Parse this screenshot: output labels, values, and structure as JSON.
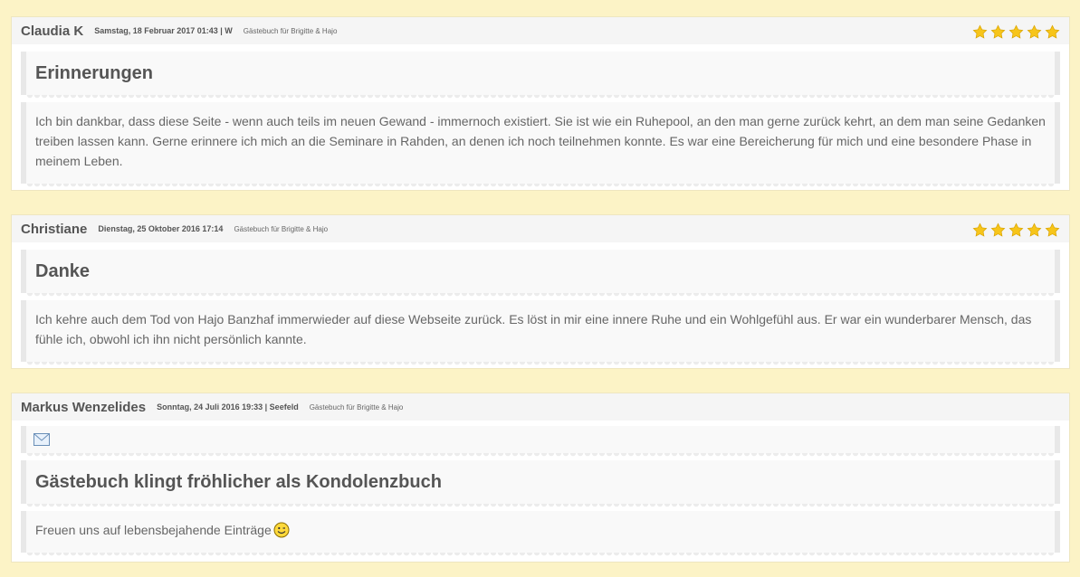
{
  "entries": [
    {
      "author": "Claudia K",
      "meta": "Samstag, 18 Februar 2017 01:43 | W",
      "guestbook": "Gästebuch für Brigitte & Hajo",
      "rating": 5,
      "title": "Erinnerungen",
      "body": "Ich bin dankbar, dass diese Seite - wenn auch teils im neuen Gewand - immernoch existiert. Sie ist wie ein Ruhepool, an den man gerne zurück kehrt, an dem man seine Gedanken treiben lassen kann. Gerne erinnere ich mich an die Seminare in Rahden, an denen ich noch teilnehmen konnte. Es war eine Bereicherung für mich und eine besondere Phase in meinem Leben."
    },
    {
      "author": "Christiane",
      "meta": "Dienstag, 25 Oktober 2016 17:14",
      "guestbook": "Gästebuch für Brigitte & Hajo",
      "rating": 5,
      "title": "Danke",
      "body": "Ich kehre auch dem Tod von Hajo Banzhaf immerwieder auf diese Webseite zurück. Es löst in mir eine innere Ruhe und ein Wohlgefühl aus. Er war ein wunderbarer Mensch, das fühle ich, obwohl ich ihn nicht persönlich kannte."
    },
    {
      "author": "Markus Wenzelides",
      "meta": "Sonntag, 24 Juli 2016 19:33 | Seefeld",
      "guestbook": "Gästebuch für Brigitte & Hajo",
      "title": "Gästebuch klingt fröhlicher als Kondolenzbuch",
      "body": "Freuen uns auf lebensbejahende Einträge",
      "icons": {
        "mail": "mail-icon",
        "smiley": "smiley-icon"
      }
    }
  ],
  "colors": {
    "background": "#fcf3c6",
    "star": "#f7c51a",
    "text": "#555555"
  }
}
